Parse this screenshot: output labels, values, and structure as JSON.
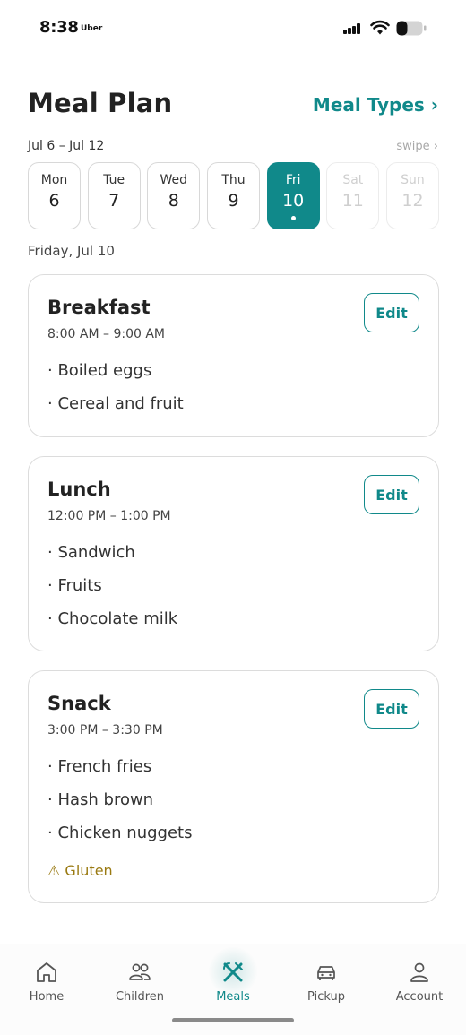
{
  "status_bar": {
    "time": "8:38",
    "carrier": "Uber"
  },
  "header": {
    "title": "Meal Plan",
    "meal_types_link": "Meal Types ›"
  },
  "week": {
    "range": "Jul 6 – Jul 12",
    "swipe_hint": "swipe ›",
    "days": [
      {
        "name": "Mon",
        "num": "6",
        "state": "normal"
      },
      {
        "name": "Tue",
        "num": "7",
        "state": "normal"
      },
      {
        "name": "Wed",
        "num": "8",
        "state": "normal"
      },
      {
        "name": "Thu",
        "num": "9",
        "state": "normal"
      },
      {
        "name": "Fri",
        "num": "10",
        "state": "selected"
      },
      {
        "name": "Sat",
        "num": "11",
        "state": "disabled"
      },
      {
        "name": "Sun",
        "num": "12",
        "state": "disabled"
      }
    ]
  },
  "selected_date": "Friday, Jul 10",
  "meals": [
    {
      "name": "Breakfast",
      "time": "8:00 AM – 9:00 AM",
      "edit_label": "Edit",
      "items": [
        "· Boiled eggs",
        "· Cereal and fruit"
      ]
    },
    {
      "name": "Lunch",
      "time": "12:00 PM – 1:00 PM",
      "edit_label": "Edit",
      "items": [
        "· Sandwich",
        "· Fruits",
        "· Chocolate milk"
      ]
    },
    {
      "name": "Snack",
      "time": "3:00 PM – 3:30 PM",
      "edit_label": "Edit",
      "items": [
        "· French fries",
        "· Hash brown",
        "· Chicken nuggets"
      ],
      "allergy": "⚠ Gluten"
    }
  ],
  "nav": {
    "items": [
      {
        "label": "Home",
        "icon": "home-icon"
      },
      {
        "label": "Children",
        "icon": "children-icon"
      },
      {
        "label": "Meals",
        "icon": "meals-icon",
        "active": true
      },
      {
        "label": "Pickup",
        "icon": "car-icon"
      },
      {
        "label": "Account",
        "icon": "account-icon"
      }
    ]
  },
  "colors": {
    "accent": "#10898a",
    "allergy": "#9a7a12"
  }
}
